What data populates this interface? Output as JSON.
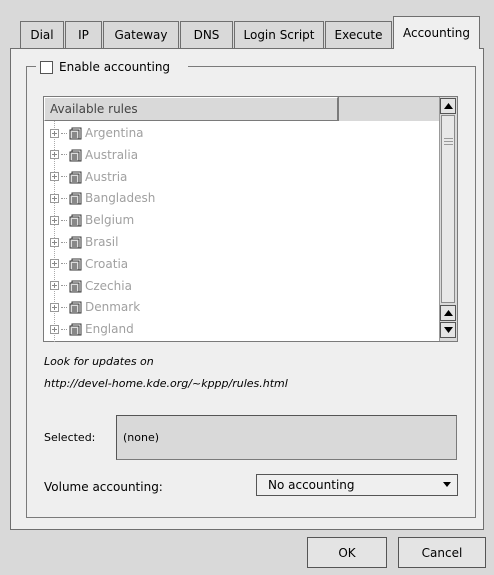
{
  "tabs": [
    {
      "label": "Dial"
    },
    {
      "label": "IP"
    },
    {
      "label": "Gateway"
    },
    {
      "label": "DNS"
    },
    {
      "label": "Login Script"
    },
    {
      "label": "Execute"
    },
    {
      "label": "Accounting",
      "active": true
    }
  ],
  "enable_accounting": {
    "label": "Enable accounting",
    "checked": false
  },
  "rules_list": {
    "header": "Available rules",
    "items": [
      "Argentina",
      "Australia",
      "Austria",
      "Bangladesh",
      "Belgium",
      "Brasil",
      "Croatia",
      "Czechia",
      "Denmark",
      "England"
    ]
  },
  "updates": {
    "line1": "Look for updates on",
    "line2": "http://devel-home.kde.org/~kppp/rules.html"
  },
  "selected": {
    "label": "Selected:",
    "value": "(none)"
  },
  "volume_accounting": {
    "label": "Volume accounting:",
    "value": "No accounting"
  },
  "buttons": {
    "ok": "OK",
    "cancel": "Cancel"
  },
  "icons": {
    "rule_item": "document-icon",
    "expander": "plus-expander-icon"
  }
}
